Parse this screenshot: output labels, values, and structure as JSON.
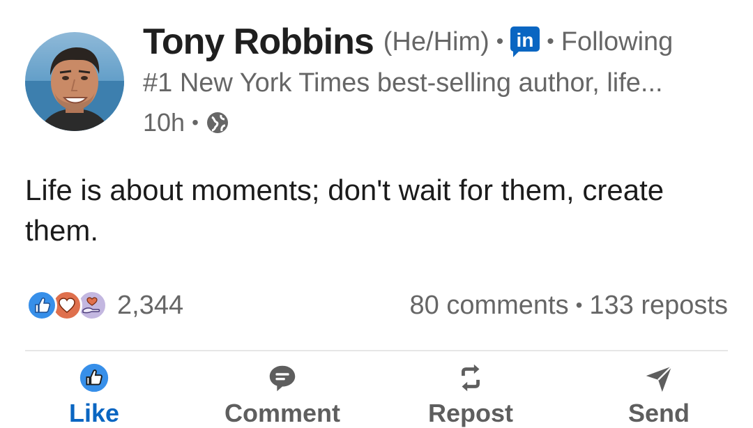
{
  "post": {
    "author": {
      "name": "Tony Robbins",
      "pronouns": "(He/Him)",
      "badge_icon": "linkedin-premium-icon",
      "follow_status": "Following",
      "headline": "#1 New York Times best-selling author, life...",
      "avatar_icon": "profile-photo"
    },
    "meta": {
      "time": "10h",
      "visibility_icon": "globe-icon"
    },
    "separator": "•",
    "text": "Life is about moments; don't wait for them, create them."
  },
  "social": {
    "reaction_icons": [
      "like-reaction-icon",
      "love-reaction-icon",
      "support-reaction-icon"
    ],
    "reaction_count": "2,344",
    "comments": "80 comments",
    "reposts": "133 reposts"
  },
  "actions": [
    {
      "label": "Like",
      "icon": "thumbs-up-icon",
      "active": true
    },
    {
      "label": "Comment",
      "icon": "comment-icon",
      "active": false
    },
    {
      "label": "Repost",
      "icon": "repost-icon",
      "active": false
    },
    {
      "label": "Send",
      "icon": "send-icon",
      "active": false
    }
  ],
  "colors": {
    "linkedin_blue": "#0a66c2",
    "text_primary": "#1b1b1b",
    "text_secondary": "#666666",
    "action_gray": "#5e5e5e",
    "like_reaction": "#378fe9",
    "love_reaction": "#df704d",
    "support_reaction": "#c3b7e0"
  }
}
